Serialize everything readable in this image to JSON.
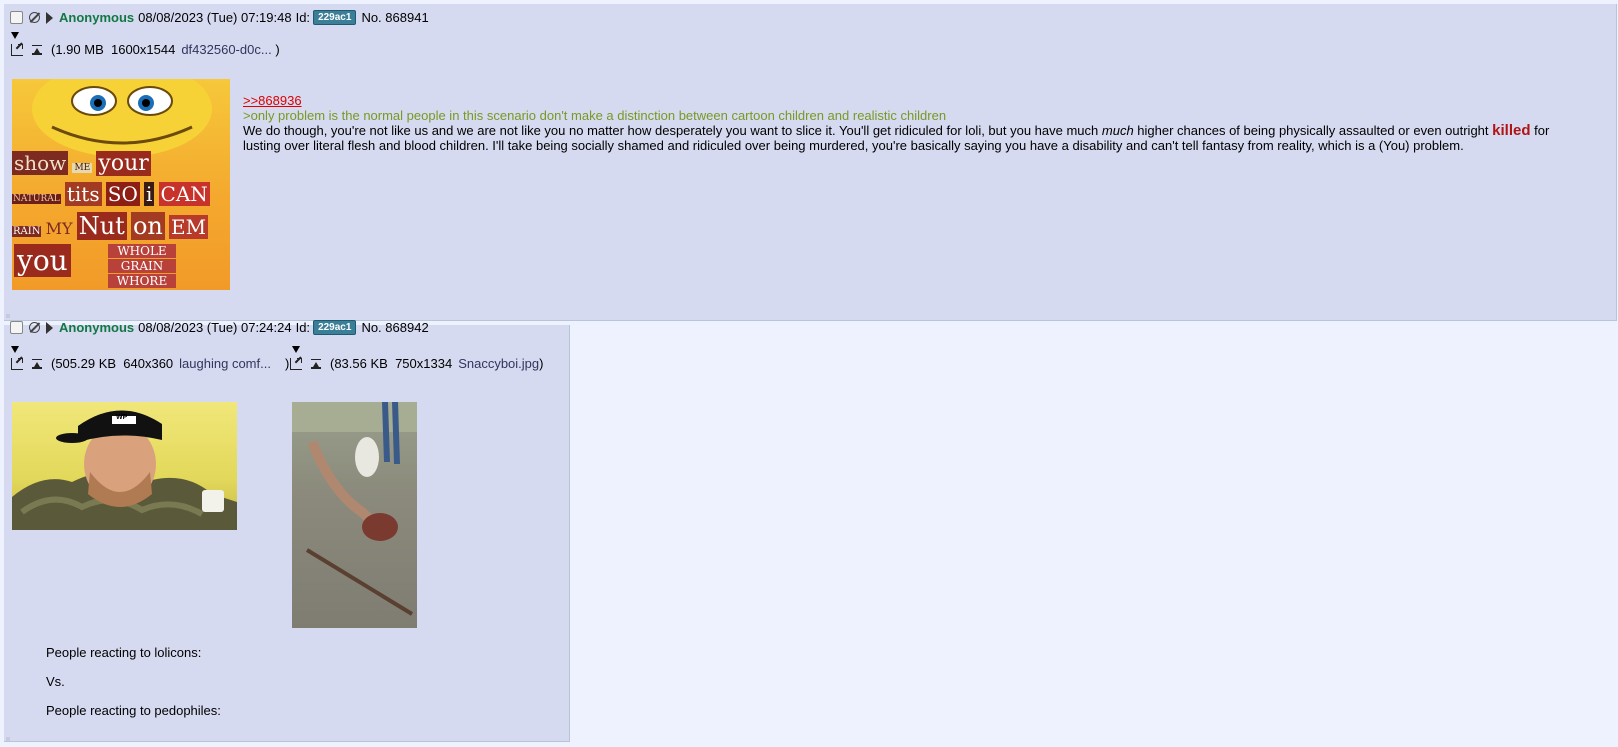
{
  "posts": [
    {
      "name": "Anonymous",
      "date": "08/08/2023 (Tue) 07:19:48",
      "id_label": "Id:",
      "id": "229ac1",
      "no_label": "No.",
      "no": "868941",
      "files": [
        {
          "size": "(1.90 MB",
          "dims": "1600x1544",
          "name": "df432560-d0c...",
          "close": ")"
        }
      ],
      "thumb_text": {
        "l1a": "show",
        "l1b": "ME",
        "l1c": "your",
        "l2a": "NATURAL",
        "l2b": "tits",
        "l2c": "SO",
        "l2d": "i",
        "l2e": "CAN",
        "l3a": "RAIN",
        "l3b": "MY",
        "l3c": "Nut",
        "l3d": "on",
        "l3e": "EM",
        "l4a": "you",
        "l4b": "WHOLE",
        "l4c": "GRAIN",
        "l4d": "WHORE"
      },
      "quote_link": ">>868936",
      "greentext": ">only problem is the normal people in this scenario don't make a distinction between cartoon children and realistic children",
      "body_part1": "We do though, you're not like us and we are not like you no matter how desperately you want to slice it. You'll get ridiculed for loli, but you have much ",
      "body_em": "much",
      "body_part2": " higher chances of being physically assaulted or even outright ",
      "body_killed": "killed",
      "body_part3": " for",
      "body_line2": "lusting over literal flesh and blood children. I'll take being socially shamed and ridiculed over being murdered, you're basically saying you have a disability and can't tell fantasy from reality, which is a (You) problem."
    },
    {
      "name": "Anonymous",
      "date": "08/08/2023 (Tue) 07:24:24",
      "id_label": "Id:",
      "id": "229ac1",
      "no_label": "No.",
      "no": "868942",
      "files": [
        {
          "size": "(505.29 KB",
          "dims": "640x360",
          "name": "laughing comf...",
          "close": ")"
        },
        {
          "size": "(83.56 KB",
          "dims": "750x1334",
          "name": "Snaccyboi.jpg",
          "close": ")"
        }
      ],
      "thumb_cap_text": "WP",
      "lines": [
        "People reacting to lolicons:",
        "Vs.",
        "People reacting to pedophiles:"
      ]
    }
  ],
  "colors": {
    "page_bg": "#eef2ff",
    "post_bg": "#d6daf0",
    "name": "#117743",
    "greentext": "#789922",
    "quotelink": "#dd0000",
    "killed": "#b01515",
    "id_badge": "#3a7e97"
  },
  "icons": [
    "checkbox-icon",
    "hide-icon",
    "post-menu-triangle-icon",
    "dropdown-triangle-icon",
    "external-link-icon",
    "download-icon"
  ]
}
